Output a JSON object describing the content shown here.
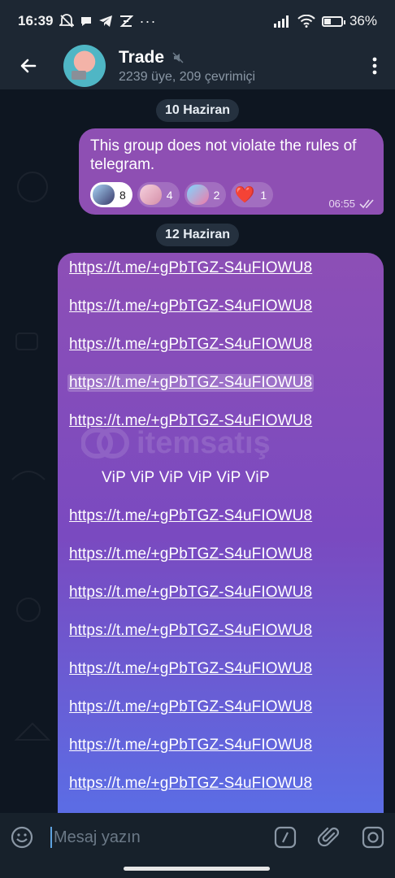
{
  "status_bar": {
    "time": "16:39",
    "battery": "36%",
    "left_icons": [
      "mute-icon",
      "chat-bubble-icon",
      "telegram-icon",
      "app-icon",
      "more-dots-icon"
    ],
    "right_icons": [
      "signal-icon",
      "wifi-icon",
      "battery-icon"
    ]
  },
  "header": {
    "title": "Trade",
    "muted": true,
    "subtitle": "2239 üye, 209 çevrimiçi"
  },
  "chat": {
    "date_1": "10 Haziran",
    "message_1": {
      "text": "This group does not violate the rules of telegram.",
      "time": "06:55",
      "status": "read",
      "reactions": [
        {
          "emoji": "anime-sticker",
          "count": "8",
          "self": true
        },
        {
          "emoji": "anime-sticker",
          "count": "4",
          "self": false
        },
        {
          "emoji": "anime-sticker",
          "count": "2",
          "self": false
        },
        {
          "emoji": "❤️",
          "count": "1",
          "self": false
        }
      ]
    },
    "date_2": "12 Haziran",
    "message_2": {
      "links_top": [
        "https://t.me/+gPbTGZ-S4uFIOWU8",
        "https://t.me/+gPbTGZ-S4uFIOWU8",
        "https://t.me/+gPbTGZ-S4uFIOWU8",
        "https://t.me/+gPbTGZ-S4uFIOWU8",
        "https://t.me/+gPbTGZ-S4uFIOWU8"
      ],
      "vip_line": "ViP ViP ViP ViP ViP ViP",
      "links_bottom": [
        "https://t.me/+gPbTGZ-S4uFIOWU8",
        "https://t.me/+gPbTGZ-S4uFIOWU8",
        "https://t.me/+gPbTGZ-S4uFIOWU8",
        "https://t.me/+gPbTGZ-S4uFIOWU8",
        "https://t.me/+gPbTGZ-S4uFIOWU8",
        "https://t.me/+gPbTGZ-S4uFIOWU8",
        "https://t.me/+gPbTGZ-S4uFIOWU8",
        "https://t.me/+gPbTGZ-S4uFIOWU8"
      ]
    },
    "watermark": "itemsatış"
  },
  "input": {
    "placeholder": "Mesaj yazın"
  },
  "colors": {
    "header_bg": "#1d2733",
    "chat_bg": "#0e1621",
    "bubble_purple": "#8e4fb3",
    "bubble_blue": "#5a6ee6"
  }
}
